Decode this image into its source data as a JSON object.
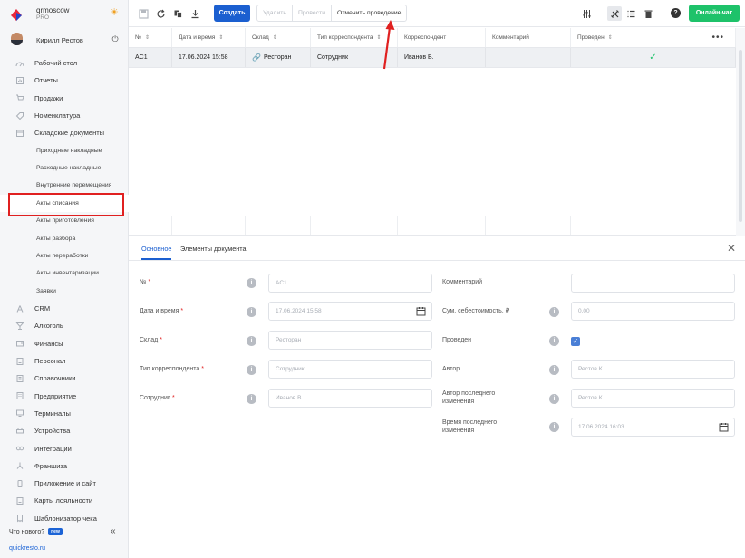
{
  "brand": {
    "name": "qrmoscow",
    "plan": "PRO"
  },
  "user": {
    "name": "Кирилл Рестов"
  },
  "sidebar": {
    "items": [
      {
        "label": "Рабочий стол",
        "icon": "dashboard-icon"
      },
      {
        "label": "Отчеты",
        "icon": "reports-icon"
      },
      {
        "label": "Продажи",
        "icon": "cart-icon"
      },
      {
        "label": "Номенклатура",
        "icon": "tag-icon"
      },
      {
        "label": "Складские документы",
        "icon": "box-icon"
      }
    ],
    "subitems": [
      "Приходные накладные",
      "Расходные накладные",
      "Внутренние перемещения",
      "Акты списания",
      "Акты приготовления",
      "Акты разбора",
      "Акты переработки",
      "Акты инвентаризации",
      "Заявки"
    ],
    "active_subitem": "Акты списания",
    "items2": [
      {
        "label": "CRM",
        "icon": "crm-icon"
      },
      {
        "label": "Алкоголь",
        "icon": "glass-icon"
      },
      {
        "label": "Финансы",
        "icon": "wallet-icon"
      },
      {
        "label": "Персонал",
        "icon": "staff-icon"
      },
      {
        "label": "Справочники",
        "icon": "book-icon"
      },
      {
        "label": "Предприятие",
        "icon": "building-icon"
      },
      {
        "label": "Терминалы",
        "icon": "terminal-icon"
      },
      {
        "label": "Устройства",
        "icon": "printer-icon"
      },
      {
        "label": "Интеграции",
        "icon": "link-icon"
      },
      {
        "label": "Франшиза",
        "icon": "network-icon"
      },
      {
        "label": "Приложение и сайт",
        "icon": "phone-icon"
      },
      {
        "label": "Карты лояльности",
        "icon": "card-icon"
      },
      {
        "label": "Шаблонизатор чека",
        "icon": "receipt-icon"
      }
    ],
    "whats_new": "Что нового?",
    "new_badge": "new",
    "footer_link": "quickresto.ru"
  },
  "toolbar": {
    "create": "Создать",
    "delete": "Удалить",
    "post": "Провести",
    "unpost": "Отменить проведение",
    "chat": "Онлайн-чат",
    "help": "?"
  },
  "table": {
    "columns": [
      "№",
      "Дата и время",
      "Склад",
      "Тип корреспондента",
      "Корреспондент",
      "Комментарий",
      "Проведен"
    ],
    "sortable": [
      true,
      true,
      true,
      true,
      false,
      false,
      true
    ],
    "rows": [
      {
        "num": "AC1",
        "datetime": "17.06.2024 15:58",
        "warehouse": "Ресторан",
        "corr_type": "Сотрудник",
        "correspondent": "Иванов В.",
        "comment": "",
        "posted": "✓"
      }
    ]
  },
  "panel": {
    "tabs": [
      "Основное",
      "Элементы документа"
    ],
    "left_fields": [
      {
        "label": "№",
        "required": "*",
        "value": "AC1"
      },
      {
        "label": "Дата и время",
        "required": "*",
        "value": "17.06.2024 15:58"
      },
      {
        "label": "Склад",
        "required": "*",
        "value": "Ресторан"
      },
      {
        "label": "Тип корреспондента",
        "required": "*",
        "value": "Сотрудник"
      },
      {
        "label": "Сотрудник",
        "required": "*",
        "value": "Иванов В."
      }
    ],
    "right_fields": [
      {
        "label": "Комментарий",
        "value": ""
      },
      {
        "label": "Сум. себестоимость, ₽",
        "value": "0,00"
      },
      {
        "label": "Проведен",
        "value": ""
      },
      {
        "label": "Автор",
        "value": "Рестов К."
      },
      {
        "label": "Автор последнего изменения",
        "value": "Рестов К."
      },
      {
        "label": "Время последнего изменения",
        "value": "17.06.2024 16:03"
      }
    ]
  },
  "colors": {
    "accent": "#1b5fd0",
    "chat": "#1ec26a",
    "highlight": "#e02020"
  }
}
